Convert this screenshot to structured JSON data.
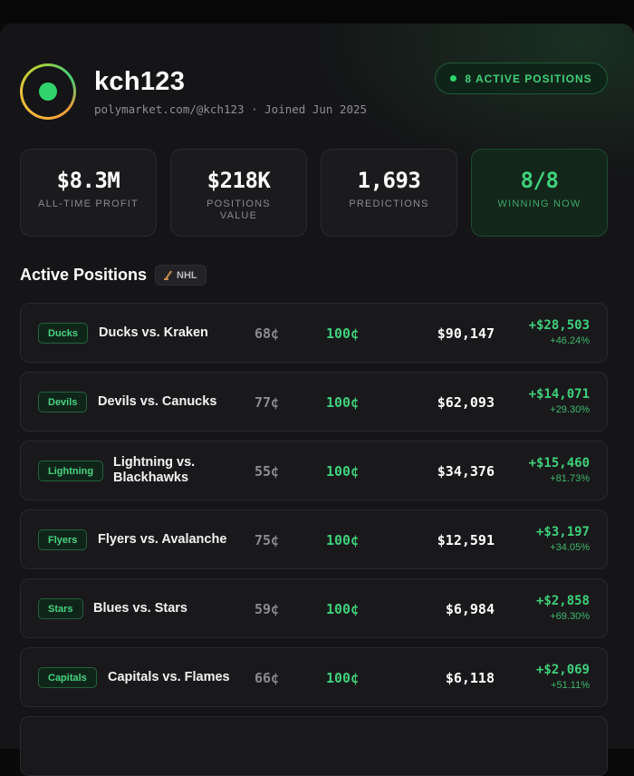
{
  "profile": {
    "username": "kch123",
    "subline": "polymarket.com/@kch123 · Joined Jun 2025",
    "active_badge": "8 ACTIVE POSITIONS"
  },
  "stats": [
    {
      "value": "$8.3M",
      "label": "ALL-TIME PROFIT"
    },
    {
      "value": "$218K",
      "label": "POSITIONS VALUE"
    },
    {
      "value": "1,693",
      "label": "PREDICTIONS"
    },
    {
      "value": "8/8",
      "label": "WINNING NOW"
    }
  ],
  "section": {
    "title": "Active Positions",
    "league": "NHL"
  },
  "positions": [
    {
      "team": "Ducks",
      "matchup": "Ducks vs. Kraken",
      "entry": "68¢",
      "current": "100¢",
      "value": "$90,147",
      "pnl": "+$28,503",
      "pnl_pct": "+46.24%"
    },
    {
      "team": "Devils",
      "matchup": "Devils vs. Canucks",
      "entry": "77¢",
      "current": "100¢",
      "value": "$62,093",
      "pnl": "+$14,071",
      "pnl_pct": "+29.30%"
    },
    {
      "team": "Lightning",
      "matchup": "Lightning vs. Blackhawks",
      "entry": "55¢",
      "current": "100¢",
      "value": "$34,376",
      "pnl": "+$15,460",
      "pnl_pct": "+81.73%"
    },
    {
      "team": "Flyers",
      "matchup": "Flyers vs. Avalanche",
      "entry": "75¢",
      "current": "100¢",
      "value": "$12,591",
      "pnl": "+$3,197",
      "pnl_pct": "+34.05%"
    },
    {
      "team": "Stars",
      "matchup": "Blues vs. Stars",
      "entry": "59¢",
      "current": "100¢",
      "value": "$6,984",
      "pnl": "+$2,858",
      "pnl_pct": "+69.30%"
    },
    {
      "team": "Capitals",
      "matchup": "Capitals vs. Flames",
      "entry": "66¢",
      "current": "100¢",
      "value": "$6,118",
      "pnl": "+$2,069",
      "pnl_pct": "+51.11%"
    }
  ],
  "colors": {
    "accent_green": "#3fd07a",
    "background": "#151517",
    "card": "#1b1b1e"
  }
}
